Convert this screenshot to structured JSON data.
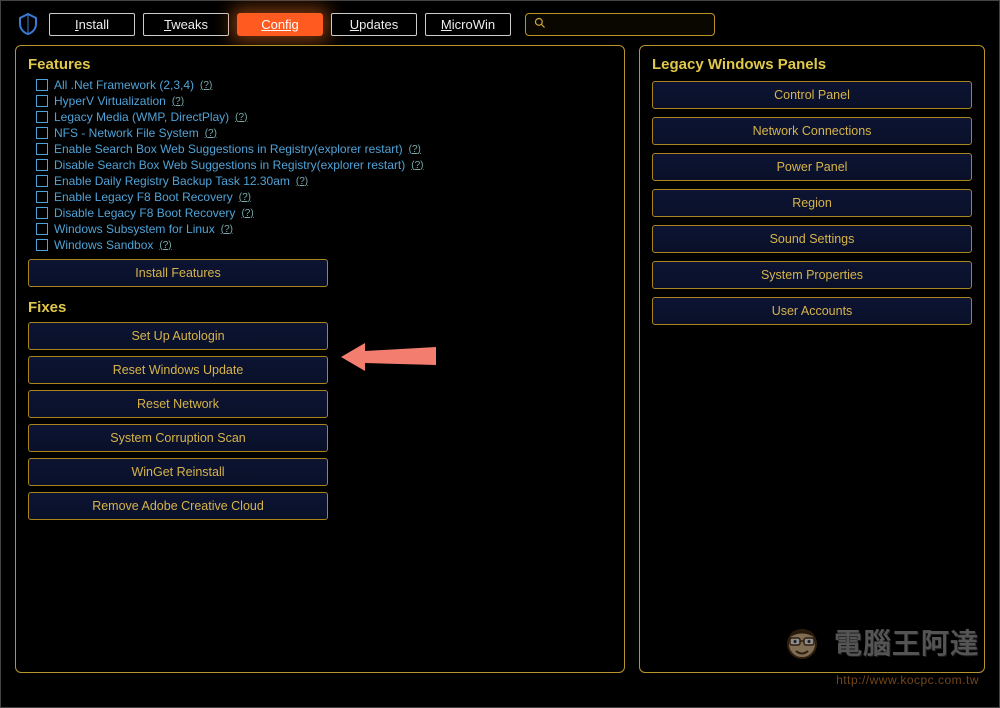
{
  "nav": {
    "install": "Install",
    "tweaks": "Tweaks",
    "config": "Config",
    "updates": "Updates",
    "microwin": "MicroWin"
  },
  "search": {
    "placeholder": ""
  },
  "features": {
    "title": "Features",
    "items": [
      "All .Net Framework (2,3,4)",
      "HyperV Virtualization",
      "Legacy Media (WMP, DirectPlay)",
      "NFS - Network File System",
      "Enable Search Box Web Suggestions in Registry(explorer restart)",
      "Disable Search Box Web Suggestions in Registry(explorer restart)",
      "Enable Daily Registry Backup Task 12.30am",
      "Enable Legacy F8 Boot Recovery",
      "Disable Legacy F8 Boot Recovery",
      "Windows Subsystem for Linux",
      "Windows Sandbox"
    ],
    "help": "(?)",
    "install_btn": "Install Features"
  },
  "fixes": {
    "title": "Fixes",
    "buttons": [
      "Set Up Autologin",
      "Reset Windows Update",
      "Reset Network",
      "System Corruption Scan",
      "WinGet Reinstall",
      "Remove Adobe Creative Cloud"
    ]
  },
  "legacy": {
    "title": "Legacy Windows Panels",
    "buttons": [
      "Control Panel",
      "Network Connections",
      "Power Panel",
      "Region",
      "Sound Settings",
      "System Properties",
      "User Accounts"
    ]
  },
  "watermark": {
    "text": "電腦王阿達",
    "url": "http://www.kocpc.com.tw"
  }
}
